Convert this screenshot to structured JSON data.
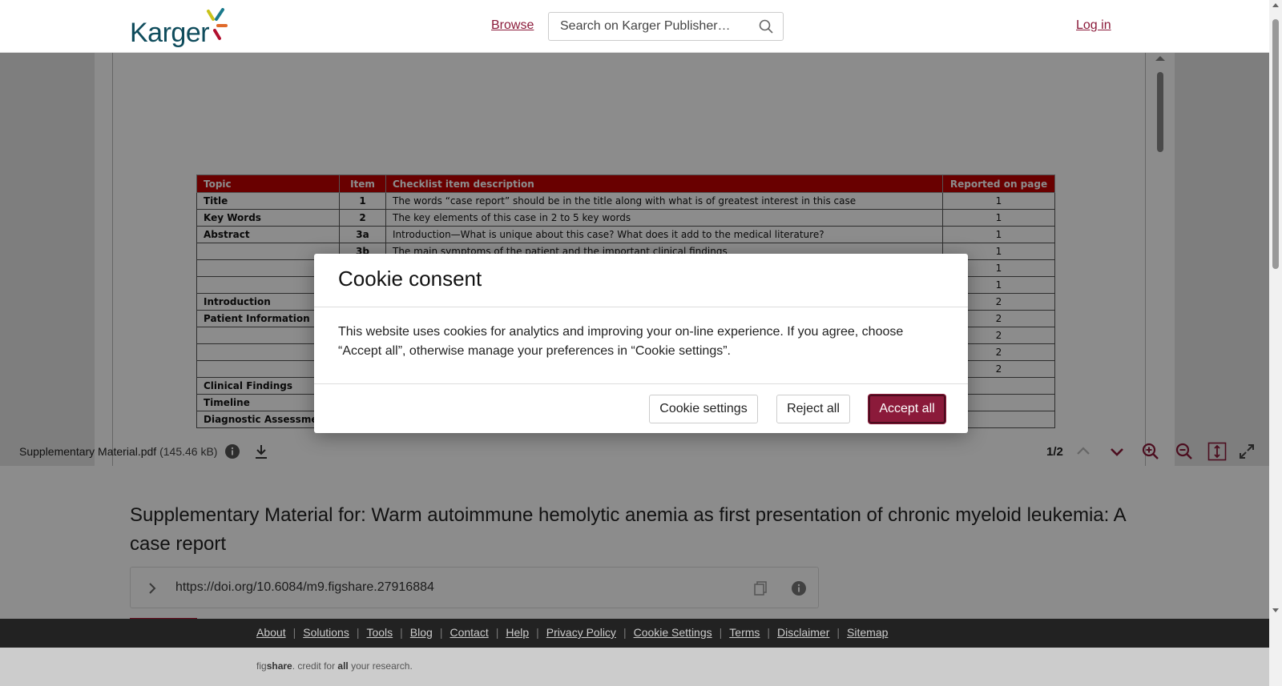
{
  "header": {
    "logo_text": "Karger",
    "browse_label": "Browse",
    "search_placeholder": "Search on Karger Publisher…",
    "login_label": "Log in"
  },
  "pdf": {
    "columns": [
      "Topic",
      "Item",
      "Checklist item description",
      "Reported on page"
    ],
    "rows": [
      {
        "topic": "Title",
        "item": "1",
        "desc": "The words “case report” should be in the title along with what is of greatest interest in this case",
        "page": "1"
      },
      {
        "topic": "Key Words",
        "item": "2",
        "desc": "The key elements of this case in 2 to 5 key words",
        "page": "1"
      },
      {
        "topic": "Abstract",
        "item": "3a",
        "desc": "Introduction—What is unique about this case? What does it add to the medical literature?",
        "page": "1"
      },
      {
        "topic": "",
        "item": "3b",
        "desc": "The main symptoms of the patient and the important clinical findings",
        "page": "1"
      },
      {
        "topic": "",
        "item": "",
        "desc": "",
        "page": "1"
      },
      {
        "topic": "",
        "item": "",
        "desc": "",
        "page": "1"
      },
      {
        "topic": "Introduction",
        "item": "",
        "desc": "",
        "page": "2"
      },
      {
        "topic": "Patient Information",
        "item": "",
        "desc": "",
        "page": "2"
      },
      {
        "topic": "",
        "item": "",
        "desc": "",
        "page": "2"
      },
      {
        "topic": "",
        "item": "",
        "desc": "",
        "page": "2"
      },
      {
        "topic": "",
        "item": "",
        "desc": "",
        "page": "2"
      },
      {
        "topic": "Clinical Findings",
        "item": "",
        "desc": "",
        "page": ""
      },
      {
        "topic": "Timeline",
        "item": "",
        "desc": "",
        "page": ""
      },
      {
        "topic": "Diagnostic Assessment",
        "item": "",
        "desc": "",
        "page": ""
      }
    ]
  },
  "viewer_toolbar": {
    "file_name": "Supplementary Material.pdf",
    "file_size": "(145.46 kB)",
    "page_indicator": "1/2"
  },
  "content": {
    "title": "Supplementary Material for: Warm autoimmune hemolytic anemia as first presentation of chronic myeloid leukemia: A case report",
    "doi": "https://doi.org/10.6084/m9.figshare.27916884"
  },
  "cookie_modal": {
    "title": "Cookie consent",
    "body": "This website uses cookies for analytics and improving your on-line experience. If you agree, choose “Accept all”, otherwise manage your preferences in “Cookie settings”.",
    "settings_label": "Cookie settings",
    "reject_label": "Reject all",
    "accept_label": "Accept all"
  },
  "footer": {
    "links": [
      "About",
      "Solutions",
      "Tools",
      "Blog",
      "Contact",
      "Help",
      "Privacy Policy",
      "Cookie Settings",
      "Terms",
      "Disclaimer",
      "Sitemap"
    ],
    "credit_pre": "fig",
    "credit_brand": "share",
    "credit_mid": ". credit for ",
    "credit_all": "all",
    "credit_post": " your research."
  },
  "colors": {
    "brand": "#8b1a3a",
    "table_header": "#c00000",
    "footer_bg": "#222222"
  }
}
